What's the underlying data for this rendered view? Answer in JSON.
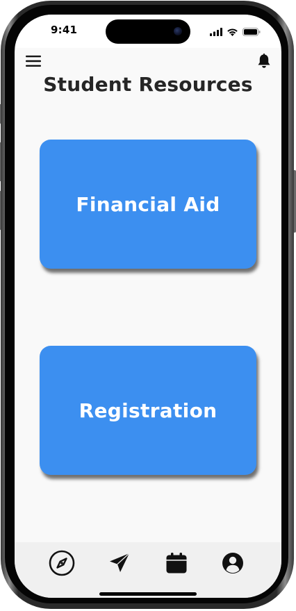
{
  "status_bar": {
    "time": "9:41",
    "icons": [
      "cellular-signal-icon",
      "wifi-icon",
      "battery-icon"
    ]
  },
  "header": {
    "menu_icon": "hamburger-menu-icon",
    "notification_icon": "bell-icon"
  },
  "page": {
    "title": "Student Resources"
  },
  "cards": [
    {
      "label": "Financial Aid"
    },
    {
      "label": "Registration"
    }
  ],
  "tab_bar": {
    "items": [
      {
        "icon": "compass-icon"
      },
      {
        "icon": "paper-plane-icon"
      },
      {
        "icon": "calendar-icon"
      },
      {
        "icon": "user-profile-icon"
      }
    ]
  },
  "colors": {
    "card_background": "#3c8ff0",
    "screen_background": "#f9f9f9",
    "title_text": "#262626",
    "tab_bar_background": "#f0f0f0"
  }
}
